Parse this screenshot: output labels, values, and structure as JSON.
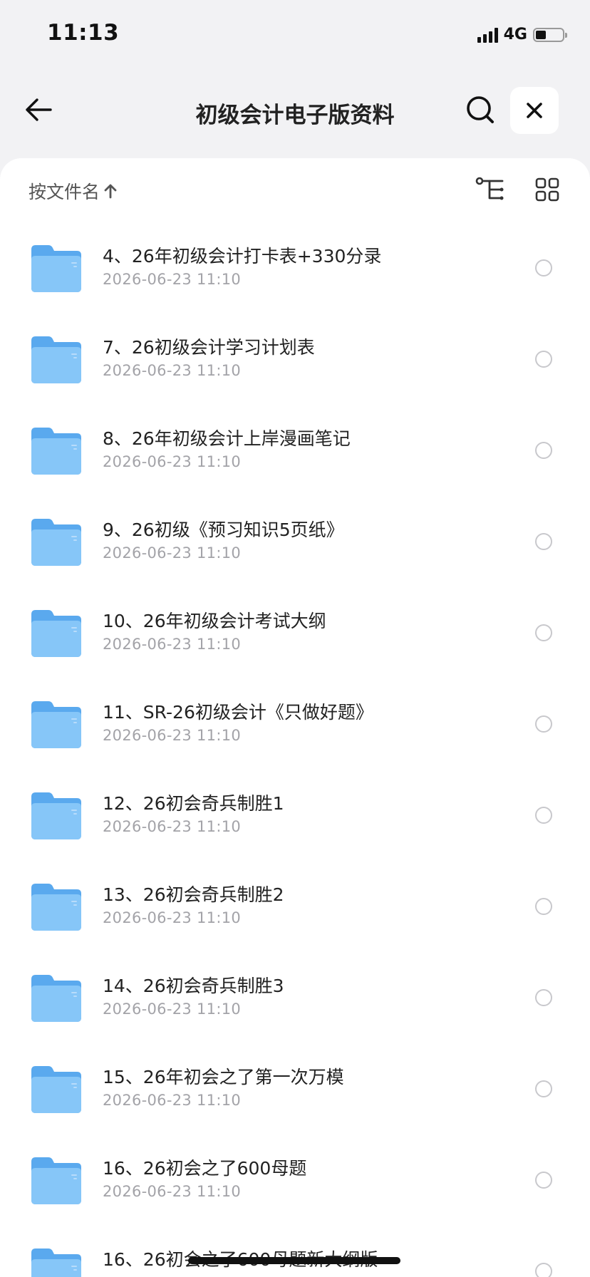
{
  "status_bar": {
    "time": "11:13",
    "network": "4G",
    "battery_level": 0.4
  },
  "nav": {
    "title": "初级会计电子版资料",
    "back_icon": "arrow-left-icon",
    "search_icon": "search-icon",
    "close_icon": "close-icon"
  },
  "toolbar": {
    "sort_label": "按文件名",
    "sort_icon": "arrow-up-icon",
    "tree_icon": "tree-view-icon",
    "grid_icon": "grid-view-icon"
  },
  "files": [
    {
      "name": "4、26年初级会计打卡表+330分录",
      "date": "2026-06-23 11:10"
    },
    {
      "name": "7、26初级会计学习计划表",
      "date": "2026-06-23 11:10"
    },
    {
      "name": "8、26年初级会计上岸漫画笔记",
      "date": "2026-06-23 11:10"
    },
    {
      "name": "9、26初级《预习知识5页纸》",
      "date": "2026-06-23 11:10"
    },
    {
      "name": "10、26年初级会计考试大纲",
      "date": "2026-06-23 11:10"
    },
    {
      "name": "11、SR-26初级会计《只做好题》",
      "date": "2026-06-23 11:10"
    },
    {
      "name": "12、26初会奇兵制胜1",
      "date": "2026-06-23 11:10"
    },
    {
      "name": "13、26初会奇兵制胜2",
      "date": "2026-06-23 11:10"
    },
    {
      "name": "14、26初会奇兵制胜3",
      "date": "2026-06-23 11:10"
    },
    {
      "name": "15、26年初会之了第一次万模",
      "date": "2026-06-23 11:10"
    },
    {
      "name": "16、26初会之了600母题",
      "date": "2026-06-23 11:10"
    },
    {
      "name": "16、26初会之了600母题新大纲版",
      "date": ""
    }
  ],
  "colors": {
    "folder_front": "#7cc1f7",
    "folder_back": "#5aa9ee",
    "date_text": "#a3a3a8",
    "background": "#f2f2f4"
  }
}
